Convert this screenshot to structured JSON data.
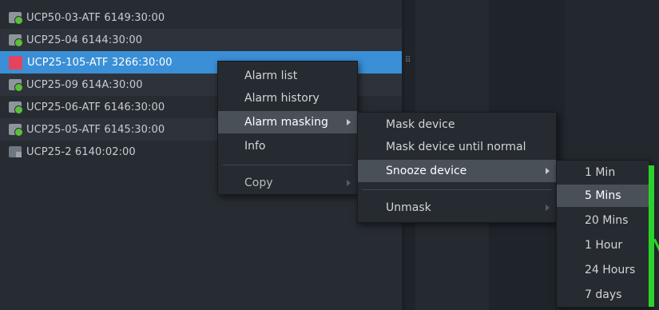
{
  "device_tree": {
    "items": [
      {
        "label": "UCP50-03-ATF 6149:30:00",
        "status": "ok"
      },
      {
        "label": "UCP25-04 6144:30:00",
        "status": "ok"
      },
      {
        "label": "UCP25-105-ATF 3266:30:00",
        "status": "alarm",
        "selected": true
      },
      {
        "label": "UCP25-09 614A:30:00",
        "status": "ok"
      },
      {
        "label": "UCP25-06-ATF 6146:30:00",
        "status": "ok"
      },
      {
        "label": "UCP25-05-ATF 6145:30:00",
        "status": "ok"
      },
      {
        "label": "UCP25-2 6140:02:00",
        "status": "offline"
      }
    ]
  },
  "context_menu": {
    "items": [
      "Alarm list",
      "Alarm history",
      "Alarm masking",
      "Info",
      "Copy"
    ]
  },
  "alarm_masking_menu": {
    "items": [
      "Mask device",
      "Mask device until normal",
      "Snooze device",
      "Unmask"
    ]
  },
  "snooze_menu": {
    "items": [
      "1 Min",
      "5 Mins",
      "20 Mins",
      "1 Hour",
      "24 Hours",
      "7 days"
    ],
    "highlighted": "5 Mins"
  },
  "icons": {
    "splitter_grip": "⠿"
  },
  "colors": {
    "selection": "#3a8fd6",
    "status_ok": "#5bbf3a",
    "status_alarm": "#e3445c",
    "indicator_green": "#2bd22b"
  }
}
